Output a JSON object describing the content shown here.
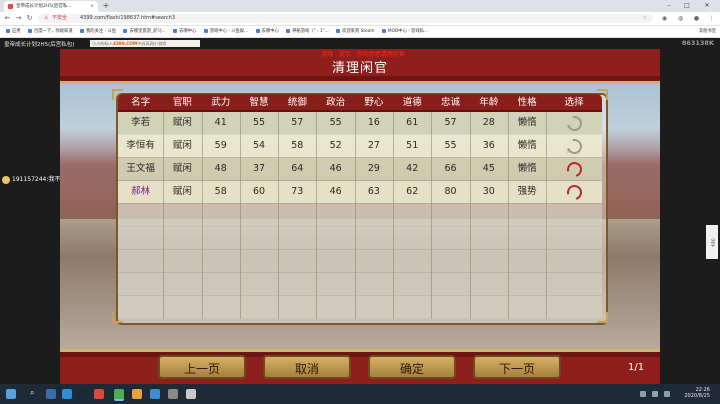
{
  "browser": {
    "tab_title": "皇帝成长计划2H5(后宫私...",
    "url_security": "不安全",
    "url": "4399.com/flash/198637.htm#search3",
    "bookmarks": [
      "应用",
      "百度一下，你就知道",
      "我的关注 - 斗鱼",
      "去哪里旅游_驴马...",
      "去哪中心",
      "游戏中心 - 斗鱼娱...",
      "去哪中心",
      "神秘游戏（\" - 1\"...",
      "欢迎来到 Steam",
      "MOD中心 - 游戏私..."
    ],
    "bookmarks_more": "其他书签"
  },
  "page": {
    "game_title": "皇帝成长计划2H5(后宫私包)",
    "counter": "863138K",
    "ad_text": "小小的标入",
    "ad_brand": "4399.COM",
    "ad_suffix": "中苏风网小游戏",
    "side_user": "191157244:我不是",
    "side_right": "分享"
  },
  "game": {
    "window_title": "清理闲官",
    "red_text": "游戏  ·  提示  · 你的意思清理闲官",
    "headers": [
      "名字",
      "官职",
      "武力",
      "智慧",
      "统御",
      "政治",
      "野心",
      "道德",
      "忠诚",
      "年龄",
      "性格",
      "选择"
    ],
    "rows": [
      {
        "name": "李若",
        "post": "赋闲",
        "wuli": "41",
        "zhihui": "55",
        "tongyu": "57",
        "zhengzhi": "55",
        "yexin": "16",
        "daode": "61",
        "zhongcheng": "57",
        "age": "28",
        "trait": "懒惰",
        "selected": false
      },
      {
        "name": "李恒有",
        "post": "赋闲",
        "wuli": "59",
        "zhihui": "54",
        "tongyu": "58",
        "zhengzhi": "52",
        "yexin": "27",
        "daode": "51",
        "zhongcheng": "55",
        "age": "36",
        "trait": "懒惰",
        "selected": false
      },
      {
        "name": "王文福",
        "post": "赋闲",
        "wuli": "48",
        "zhihui": "37",
        "tongyu": "64",
        "zhengzhi": "46",
        "yexin": "29",
        "daode": "42",
        "zhongcheng": "66",
        "age": "45",
        "trait": "懒惰",
        "selected": true
      },
      {
        "name": "郝林",
        "post": "赋闲",
        "wuli": "58",
        "zhihui": "60",
        "tongyu": "73",
        "zhengzhi": "46",
        "yexin": "63",
        "daode": "62",
        "zhongcheng": "80",
        "age": "30",
        "trait": "强势",
        "selected": true
      }
    ],
    "buttons": {
      "prev": "上一页",
      "cancel": "取消",
      "confirm": "确定",
      "next": "下一页"
    },
    "page_indicator": "1/1"
  },
  "taskbar": {
    "time": "22:26",
    "date": "2020/8/25"
  },
  "colors": {
    "header_red": "#8a1e1b",
    "frame_red": "#8e1f1c",
    "gold": "#d5b36a",
    "select_on": "#c0242a"
  }
}
